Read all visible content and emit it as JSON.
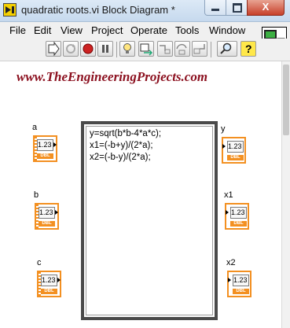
{
  "window": {
    "title": "quadratic roots.vi Block Diagram *",
    "close_label": "X"
  },
  "menu": [
    "File",
    "Edit",
    "View",
    "Project",
    "Operate",
    "Tools",
    "Window"
  ],
  "toolbar": {
    "buttons": [
      "run-arrow-icon",
      "run-continuous-icon",
      "abort-icon",
      "pause-icon",
      "highlight-execution-icon",
      "retain-wire-values-icon",
      "step-into-icon",
      "step-over-icon",
      "step-out-icon",
      "search-icon",
      "help-icon"
    ]
  },
  "vi_icon": {
    "number": "1"
  },
  "watermark": "www.TheEngineeringProjects.com",
  "formula_node": {
    "text": "y=sqrt(b*b-4*a*c);\nx1=(-b+y)/(2*a);\nx2=(-b-y)/(2*a);"
  },
  "inputs": [
    {
      "label": "a",
      "value": "1.23",
      "type": "DBL"
    },
    {
      "label": "b",
      "value": "1.23",
      "type": "DBL"
    },
    {
      "label": "c",
      "value": "1.23",
      "type": "DBL"
    }
  ],
  "outputs": [
    {
      "label": "y",
      "value": "1.23",
      "type": "DBL"
    },
    {
      "label": "x1",
      "value": "1.23",
      "type": "DBL"
    },
    {
      "label": "x2",
      "value": "1.23",
      "type": "DBL"
    }
  ],
  "colors": {
    "terminal_accent": "#f39021",
    "watermark": "#8b0f1e"
  }
}
